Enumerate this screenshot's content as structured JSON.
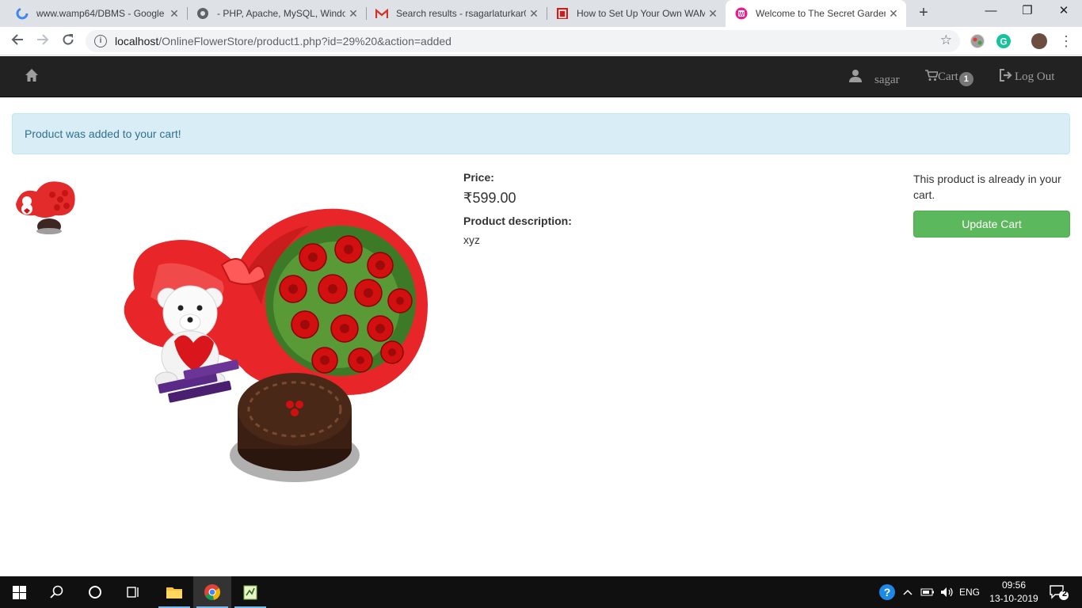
{
  "browser": {
    "tabs": [
      {
        "title": "www.wamp64/DBMS - Google",
        "favicon": "google-icon",
        "active": false
      },
      {
        "title": "- PHP, Apache, MySQL, Windo",
        "favicon": "globe-icon",
        "active": false
      },
      {
        "title": "Search results - rsagarlaturkar0",
        "favicon": "gmail-icon",
        "active": false
      },
      {
        "title": "How to Set Up Your Own WAMP",
        "favicon": "bookmark-icon",
        "active": false
      },
      {
        "title": "Welcome to The Secret Garden",
        "favicon": "site-icon",
        "active": true
      }
    ],
    "url_host": "localhost",
    "url_path": "/OnlineFlowerStore/product1.php?id=29%20&action=added"
  },
  "navbar": {
    "user_label": "sagar",
    "cart_label": "Cart",
    "cart_count": "1",
    "logout_label": "Log Out"
  },
  "alert": {
    "message": "Product was added to your cart!"
  },
  "product": {
    "price_label": "Price:",
    "price_value": "₹599.00",
    "description_label": "Product description:",
    "description_value": "xyz",
    "image_alt": "roses-bouquet-teddy-cake"
  },
  "cart_box": {
    "status_text": "This product is already in your cart.",
    "update_button": "Update Cart"
  },
  "taskbar": {
    "language": "ENG",
    "time": "09:56",
    "date": "13-10-2019",
    "notification_count": "2"
  },
  "colors": {
    "navbar_bg": "#222222",
    "alert_bg": "#d9edf7",
    "alert_text": "#31708f",
    "button_green": "#5cb85c"
  }
}
